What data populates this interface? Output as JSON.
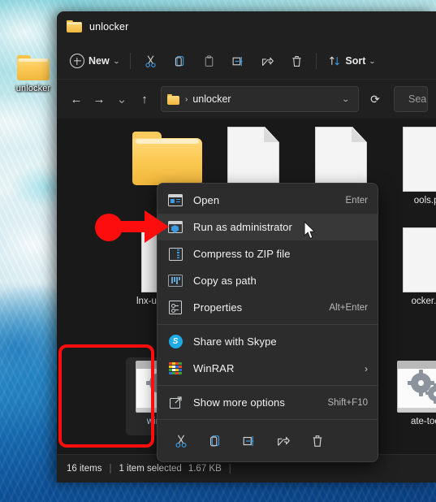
{
  "desktop": {
    "icon_label": "unlocker",
    "icon_name": "folder-icon"
  },
  "window": {
    "title": "unlocker",
    "title_icon": "folder-icon"
  },
  "toolbar": {
    "new_label": "New",
    "new_caret": "⌄",
    "sort_label": "Sort",
    "sort_caret": "⌄",
    "buttons": [
      {
        "name": "cut-icon",
        "label": "Cut"
      },
      {
        "name": "copy-icon",
        "label": "Copy"
      },
      {
        "name": "paste-icon",
        "label": "Paste"
      },
      {
        "name": "rename-icon",
        "label": "Rename"
      },
      {
        "name": "share-icon",
        "label": "Share"
      },
      {
        "name": "delete-icon",
        "label": "Delete"
      }
    ]
  },
  "navbar": {
    "back": "←",
    "forward": "→",
    "recent": "⌄",
    "up": "↑",
    "address_text": "unlocker",
    "address_separator": "›",
    "address_caret": "⌄",
    "refresh": "⟳",
    "search_placeholder": "Search unlocker",
    "search_value": "Search un"
  },
  "files": [
    {
      "name": "folder-tile",
      "label": "",
      "kind": "folder"
    },
    {
      "name": "file-tile",
      "label": "",
      "kind": "document"
    },
    {
      "name": "file-tile",
      "label": "",
      "kind": "document"
    },
    {
      "name": "file-tile",
      "label": "ools.py",
      "kind": "document"
    },
    {
      "name": "file-tile",
      "label": "lnx-uninstall.sh",
      "kind": "document"
    },
    {
      "name": "file-tile",
      "label": "ocker.py",
      "kind": "document"
    },
    {
      "name": "file-tile",
      "label": "win-install",
      "kind": "gears",
      "selected": true
    },
    {
      "name": "file-tile",
      "label": "ate-tools",
      "kind": "gears"
    }
  ],
  "context_menu": {
    "items": [
      {
        "name": "menu-item-open",
        "icon": "open-icon",
        "label": "Open",
        "accel": "Enter",
        "highlighted": false
      },
      {
        "name": "menu-item-run-as-administrator",
        "icon": "shield-admin-icon",
        "label": "Run as administrator",
        "accel": "",
        "highlighted": true
      },
      {
        "name": "menu-item-compress-to-zip",
        "icon": "zip-icon",
        "label": "Compress to ZIP file",
        "accel": "",
        "highlighted": false
      },
      {
        "name": "menu-item-copy-as-path",
        "icon": "copy-path-icon",
        "label": "Copy as path",
        "accel": "",
        "highlighted": false
      },
      {
        "name": "menu-item-properties",
        "icon": "properties-icon",
        "label": "Properties",
        "accel": "Alt+Enter",
        "highlighted": false
      }
    ],
    "items2": [
      {
        "name": "menu-item-share-with-skype",
        "icon": "skype-icon",
        "label": "Share with Skype",
        "accel": "",
        "submenu": false
      },
      {
        "name": "menu-item-winrar",
        "icon": "winrar-icon",
        "label": "WinRAR",
        "accel": "",
        "submenu": true,
        "submark": "›"
      }
    ],
    "items3": [
      {
        "name": "menu-item-show-more-options",
        "icon": "show-more-icon",
        "label": "Show more options",
        "accel": "Shift+F10"
      }
    ],
    "tool_icons": [
      {
        "name": "cut-icon",
        "label": "Cut"
      },
      {
        "name": "copy-icon",
        "label": "Copy"
      },
      {
        "name": "rename-icon",
        "label": "Rename"
      },
      {
        "name": "share-icon",
        "label": "Share"
      },
      {
        "name": "delete-icon",
        "label": "Delete"
      }
    ],
    "skype_glyph": "S"
  },
  "status": {
    "item_count": "16 items",
    "divider": "|",
    "selection": "1 item selected",
    "size": "1.67 KB",
    "trailing": "|"
  },
  "annotations": {
    "highlight_box_color": "#fd0d0d",
    "arrow_color": "#fd0d0d"
  }
}
